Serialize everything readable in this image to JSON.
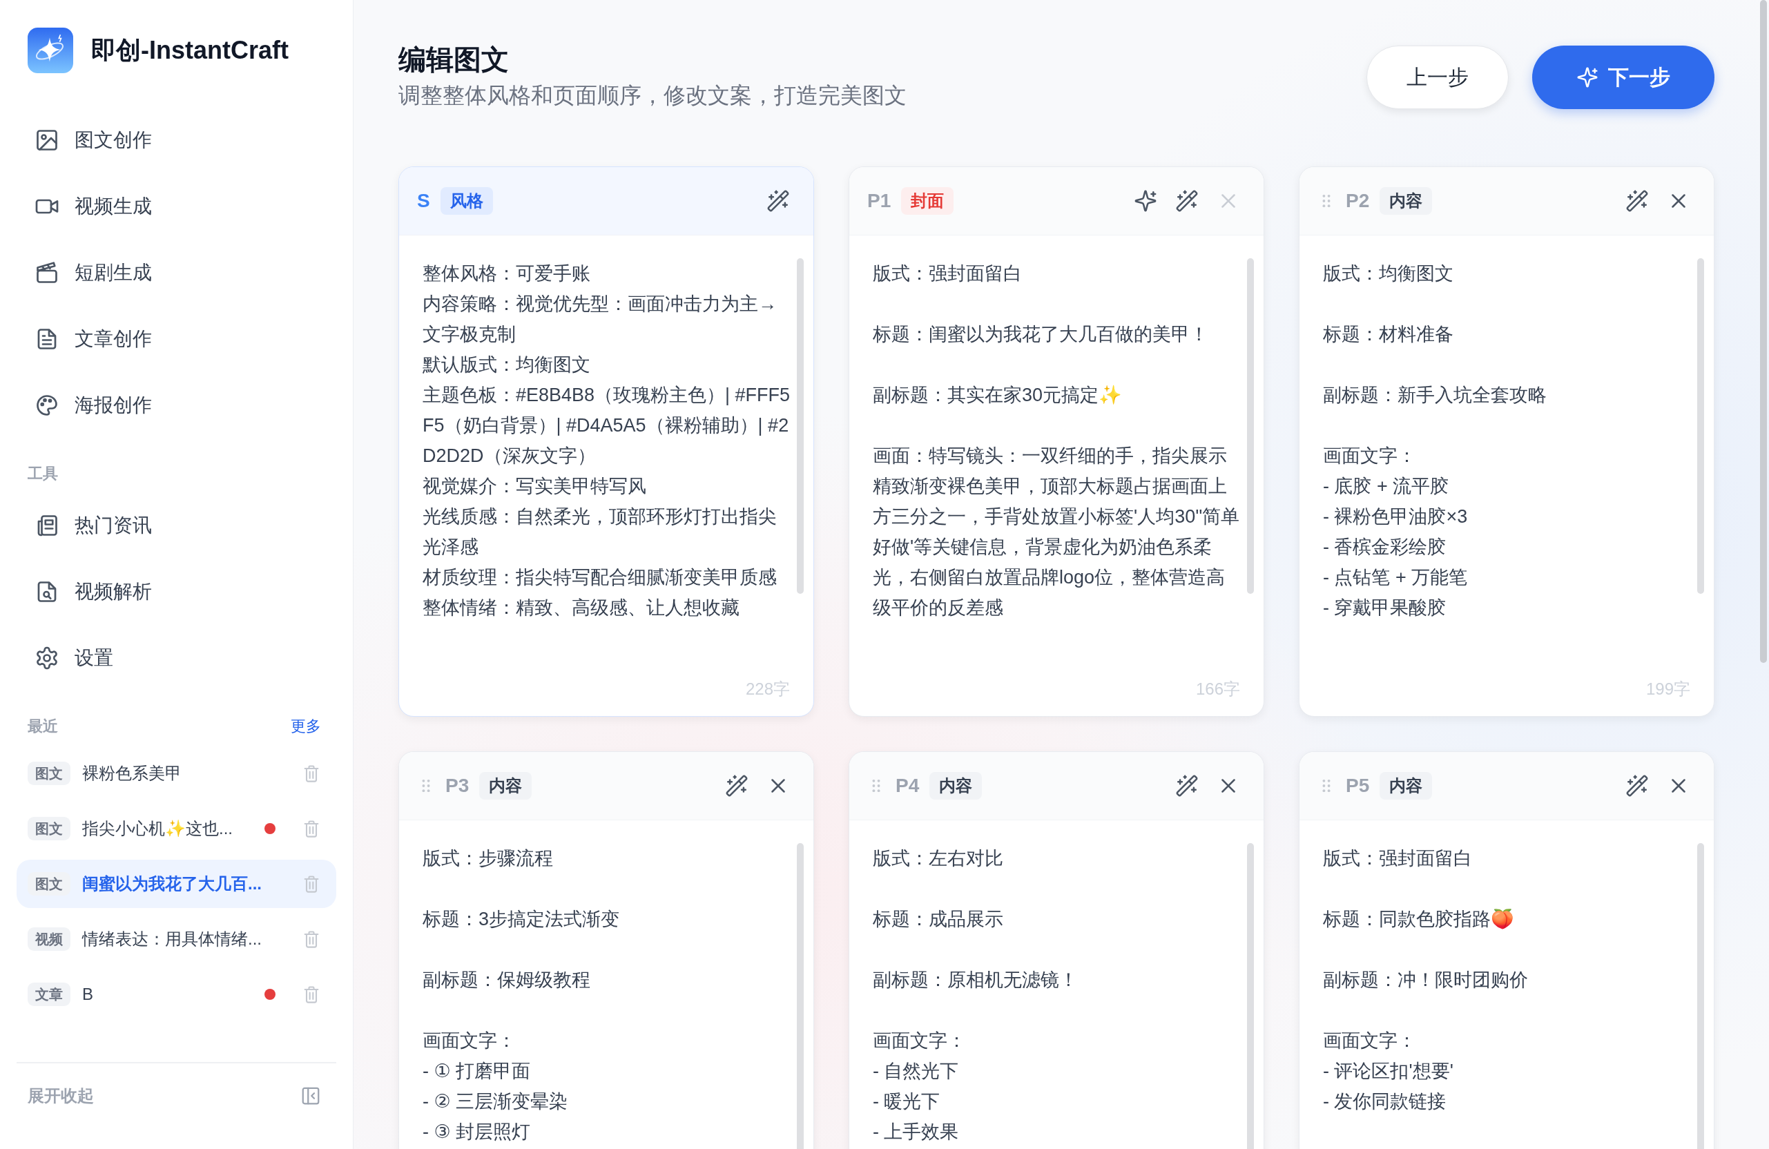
{
  "app": {
    "name": "即创-InstantCraft"
  },
  "nav": [
    {
      "label": "图文创作"
    },
    {
      "label": "视频生成"
    },
    {
      "label": "短剧生成"
    },
    {
      "label": "文章创作"
    },
    {
      "label": "海报创作"
    }
  ],
  "tools": {
    "heading": "工具",
    "items": [
      {
        "label": "热门资讯"
      },
      {
        "label": "视频解析"
      },
      {
        "label": "设置"
      }
    ]
  },
  "recent": {
    "heading": "最近",
    "more": "更多",
    "items": [
      {
        "tag": "图文",
        "title": "裸粉色系美甲",
        "unsaved": false,
        "selected": false
      },
      {
        "tag": "图文",
        "title": "指尖小心机✨这也...",
        "unsaved": true,
        "selected": false
      },
      {
        "tag": "图文",
        "title": "闺蜜以为我花了大几百...",
        "unsaved": false,
        "selected": true
      },
      {
        "tag": "视频",
        "title": "情绪表达：用具体情绪...",
        "unsaved": false,
        "selected": false
      },
      {
        "tag": "文章",
        "title": "B",
        "unsaved": true,
        "selected": false
      }
    ]
  },
  "collapse": {
    "label": "展开收起"
  },
  "header": {
    "title": "编辑图文",
    "subtitle": "调整整体风格和页面顺序，修改文案，打造完美图文",
    "buttons": [
      {
        "kind": "secondary",
        "label": "上一步"
      },
      {
        "kind": "primary",
        "label": "下一步"
      }
    ]
  },
  "cards": [
    {
      "label": "S",
      "kind": "style",
      "tag": "风格",
      "draggable": false,
      "actions": [
        {
          "kind": "polish",
          "disabled": false
        }
      ],
      "paragraphs": [
        [
          "整体风格：可爱手账",
          "内容策略：视觉优先型：画面冲击力为主→文字极克制",
          "默认版式：均衡图文",
          "主题色板：#E8B4B8（玫瑰粉主色）| #FFF5F5（奶白背景）| #D4A5A5（裸粉辅助）| #2D2D2D（深灰文字）",
          "视觉媒介：写实美甲特写风",
          "光线质感：自然柔光，顶部环形灯打出指尖光泽感",
          "材质纹理：指尖特写配合细腻渐变美甲质感",
          "整体情绪：精致、高级感、让人想收藏"
        ]
      ],
      "count": "228字"
    },
    {
      "label": "P1",
      "kind": "cover",
      "tag": "封面",
      "draggable": false,
      "actions": [
        {
          "kind": "regenerate",
          "disabled": false
        },
        {
          "kind": "polish",
          "disabled": false
        },
        {
          "kind": "delete",
          "disabled": true
        }
      ],
      "paragraphs": [
        [
          "版式：强封面留白"
        ],
        [
          "标题：闺蜜以为我花了大几百做的美甲！"
        ],
        [
          "副标题：其实在家30元搞定✨"
        ],
        [
          "画面：特写镜头：一双纤细的手，指尖展示精致渐变裸色美甲，顶部大标题占据画面上方三分之一，手背处放置小标签'人均30''简单好做'等关键信息，背景虚化为奶油色系柔光，右侧留白放置品牌logo位，整体营造高级平价的反差感"
        ]
      ],
      "count": "166字"
    },
    {
      "label": "P2",
      "kind": "content",
      "tag": "内容",
      "draggable": true,
      "actions": [
        {
          "kind": "polish",
          "disabled": false
        },
        {
          "kind": "delete",
          "disabled": false
        }
      ],
      "paragraphs": [
        [
          "版式：均衡图文"
        ],
        [
          "标题：材料准备"
        ],
        [
          "副标题：新手入坑全套攻略"
        ],
        [
          "画面文字：",
          "- 底胶 + 流平胶",
          "- 裸粉色甲油胶×3",
          "- 香槟金彩绘胶",
          "- 点钻笔 + 万能笔",
          "- 穿戴甲果酸胶"
        ]
      ],
      "count": "199字"
    },
    {
      "label": "P3",
      "kind": "content",
      "tag": "内容",
      "draggable": true,
      "actions": [
        {
          "kind": "polish",
          "disabled": false
        },
        {
          "kind": "delete",
          "disabled": false
        }
      ],
      "paragraphs": [
        [
          "版式：步骤流程"
        ],
        [
          "标题：3步搞定法式渐变"
        ],
        [
          "副标题：保姆级教程"
        ],
        [
          "画面文字：",
          "- ① 打磨甲面",
          "- ② 三层渐变晕染",
          "- ③ 封层照灯"
        ]
      ]
    },
    {
      "label": "P4",
      "kind": "content",
      "tag": "内容",
      "draggable": true,
      "actions": [
        {
          "kind": "polish",
          "disabled": false
        },
        {
          "kind": "delete",
          "disabled": false
        }
      ],
      "paragraphs": [
        [
          "版式：左右对比"
        ],
        [
          "标题：成品展示"
        ],
        [
          "副标题：原相机无滤镜！"
        ],
        [
          "画面文字：",
          "- 自然光下",
          "- 暖光下",
          "- 上手效果"
        ]
      ]
    },
    {
      "label": "P5",
      "kind": "content",
      "tag": "内容",
      "draggable": true,
      "actions": [
        {
          "kind": "polish",
          "disabled": false
        },
        {
          "kind": "delete",
          "disabled": false
        }
      ],
      "paragraphs": [
        [
          "版式：强封面留白"
        ],
        [
          "标题：同款色胶指路🍑"
        ],
        [
          "副标题：冲！限时团购价"
        ],
        [
          "画面文字：",
          "- 评论区扣'想要'",
          "- 发你同款链接"
        ]
      ]
    }
  ]
}
